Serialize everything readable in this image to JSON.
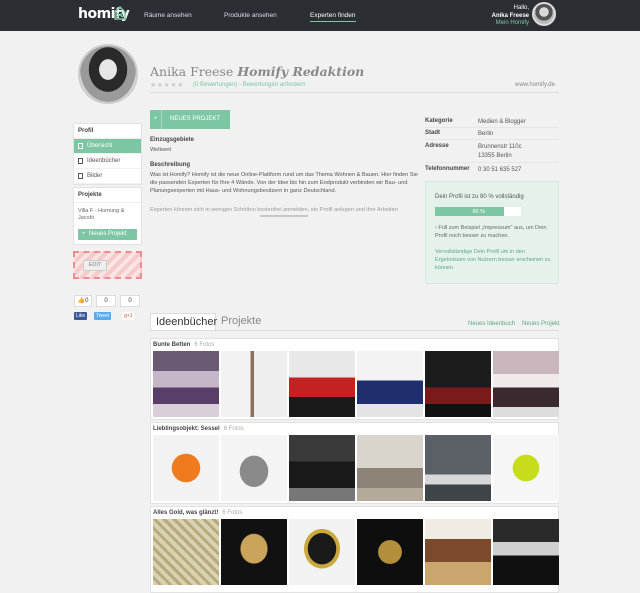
{
  "header": {
    "logo": "homify",
    "nav": [
      "Räume ansehen",
      "Produkte ansehen",
      "Experten finden"
    ],
    "greeting": "Hallo,",
    "user_name": "Anika Freese",
    "my_homify": "Mein Homify"
  },
  "profile": {
    "name": "Anika Freese",
    "company": "Homify Redaktion",
    "stars": "★★★★★",
    "reviews": "(0 Bewertungen)",
    "separator": "-",
    "request_reviews": "Bewertungen anfordern",
    "website": "www.homify.de"
  },
  "sidebar": {
    "profile_heading": "Profil",
    "items": [
      {
        "label": "Übersicht",
        "active": true,
        "icon": "overview-icon"
      },
      {
        "label": "Ideenbücher",
        "active": false,
        "icon": "book-icon"
      },
      {
        "label": "Bilder",
        "active": false,
        "icon": "image-icon"
      }
    ],
    "projects_heading": "Projekte",
    "project_name": "Villa F - Hornung & Jacobi",
    "new_project": "Neues Projekt",
    "edit": "EDIT",
    "social": {
      "like_count": "0",
      "count2": "0",
      "count3": "0",
      "like": "Like",
      "tweet": "Tweet",
      "gplus": "g+1"
    }
  },
  "main": {
    "new_project_button": "NEUES PROJEKT",
    "area_label": "Einzugsgebiete",
    "area_value": "Weltweit",
    "description_label": "Beschreibung",
    "description": "Was ist Homify? Homify ist die neue Online-Plattform rund um das Thema Wohnen & Bauen. Hier finden Sie die passenden Experten für Ihre 4 Wände. Von der Idee bis hin zum Endprodukt verbinden wir Bau- und Planungsexperten mit Haus- und Wohnungsbesitzern in ganz Deutschland.",
    "description_more": "Experten können sich in wenigen Schritten kostenfrei anmelden, ein Profil anlegen und ihre Arbeiten"
  },
  "info": {
    "rows": [
      {
        "label": "Kategorie",
        "value": "Medien & Blogger"
      },
      {
        "label": "Stadt",
        "value": "Berlin"
      },
      {
        "label": "Adresse",
        "value": "Brunnenstr 110c",
        "value2": "13355 Berlin"
      },
      {
        "label": "Telefonnummer",
        "value": "0 30 51 635 527"
      }
    ],
    "progress_title": "Dein Profil ist zu 80 % vollständig",
    "progress_value": 80,
    "progress_label": "80 %",
    "tip": "› Füll zum Beispiel „Impressum\" aus, um Dein Profil noch besser zu machen.",
    "promo": "Vervollständige Dein Profil um in den Ergebnissen von Nutzern besser erscheinen zu können."
  },
  "tabs": {
    "items": [
      "Ideenbücher",
      "Projekte"
    ],
    "new_book": "Neues Ideenbuch",
    "new_project": "Neues Projekt"
  },
  "books": [
    {
      "title": "Bunte Betten",
      "count": "6 Fotos",
      "photos": [
        "bedroom-purple",
        "bedroom-white",
        "red-sofa",
        "blue-bed",
        "dark-bed",
        "pink-bedroom"
      ]
    },
    {
      "title": "Lieblingsobjekt: Sessel",
      "count": "6 Fotos",
      "photos": [
        "orange-chair",
        "grey-chair",
        "black-lounge",
        "living-room",
        "grey-lounge",
        "yellow-chair"
      ]
    },
    {
      "title": "Alles Gold, was glänzt!",
      "count": "6 Fotos",
      "photos": [
        "gold-wallpaper",
        "chandelier",
        "gold-armchair",
        "gold-art",
        "hallway",
        "kitchen"
      ]
    }
  ],
  "colors": {
    "accent": "#7cc6a3",
    "topbar": "#2b2e33",
    "edit": "#f08c8c"
  }
}
